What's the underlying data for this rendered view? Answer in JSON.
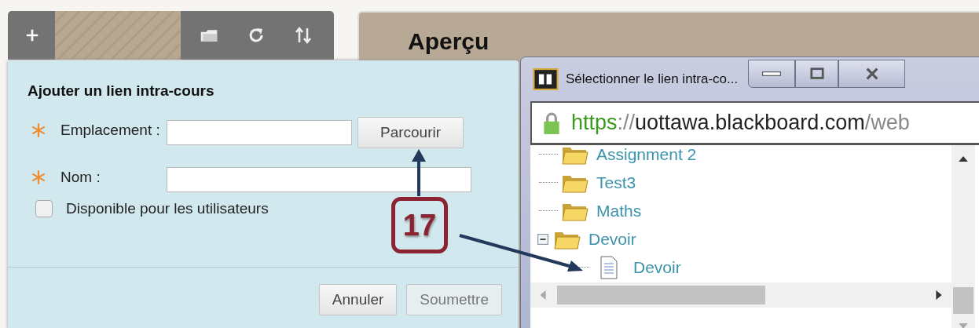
{
  "background_heading": "Aperçu",
  "dialog": {
    "title": "Ajouter un lien intra-cours",
    "fields": [
      {
        "label": "Emplacement :",
        "required": true,
        "kind": "browse",
        "button": "Parcourir"
      },
      {
        "label": "Nom :",
        "required": true,
        "kind": "text"
      }
    ],
    "checkbox": {
      "label": "Disponible pour les utilisateurs",
      "checked": false
    },
    "buttons": [
      {
        "label": "Annuler",
        "disabled": false
      },
      {
        "label": "Soumettre",
        "disabled": true
      }
    ]
  },
  "popup": {
    "title": "Sélectionner le lien intra-co...",
    "url": [
      {
        "text": "https",
        "kind": "scheme"
      },
      {
        "text": "://",
        "kind": "separator"
      },
      {
        "text": "uottawa.blackboard.com",
        "kind": "host"
      },
      {
        "text": "/web",
        "kind": "path"
      }
    ],
    "tree": [
      {
        "label": "Assignment 2",
        "kind": "folder"
      },
      {
        "label": "Test3",
        "kind": "folder"
      },
      {
        "label": "Maths",
        "kind": "folder"
      },
      {
        "label": "Devoir",
        "kind": "folder",
        "expanded": true,
        "children": [
          {
            "label": "Devoir",
            "kind": "file"
          }
        ]
      }
    ]
  },
  "annotation": {
    "number": "17"
  }
}
